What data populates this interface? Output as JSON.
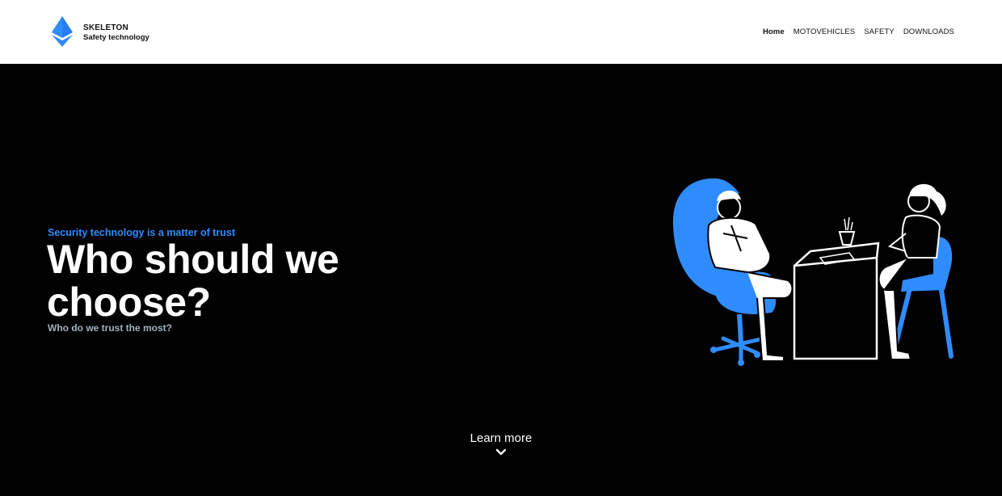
{
  "header": {
    "brand_name": "SKELETON",
    "brand_tagline": "Safety technology",
    "logo_icon": "diamond-logo-icon",
    "accent_color": "#2f8cff"
  },
  "nav": {
    "items": [
      {
        "label": "Home",
        "active": true
      },
      {
        "label": "MOTOVEHICLES",
        "active": false
      },
      {
        "label": "SAFETY",
        "active": false
      },
      {
        "label": "DOWNLOADS",
        "active": false
      }
    ]
  },
  "hero": {
    "eyebrow": "Security technology is a matter of trust",
    "headline": "Who should we choose?",
    "subline": "Who do we trust the most?",
    "illustration": "consultation-illustration",
    "learn_more": "Learn more",
    "learn_more_icon": "chevron-down-icon"
  }
}
